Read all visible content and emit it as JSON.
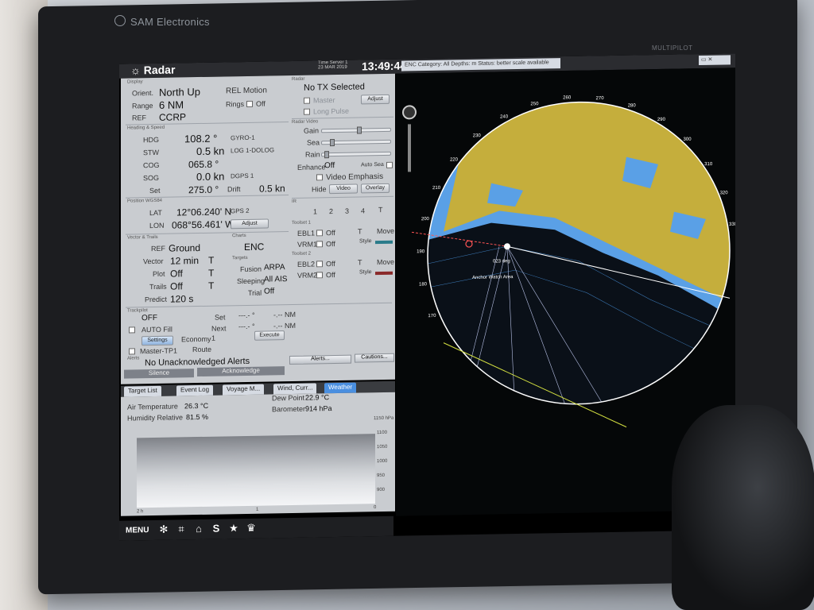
{
  "bezel": {
    "brand": "SAM Electronics",
    "model": "MULTIPILOT"
  },
  "topbar": {
    "title": "Radar",
    "time_zone_line1": "Time Server 1",
    "time_zone_line2": "23 MAR 2019",
    "clock": "13:49:44 LT",
    "enc_status": "ENC Category: All  Depths: m  Status: better scale available"
  },
  "display": {
    "section": "Display",
    "orient_label": "Orient.",
    "orient_value": "North Up",
    "motion": "REL Motion",
    "range_label": "Range",
    "range_value": "6 NM",
    "rings_label": "Rings",
    "rings_value": "Off",
    "ref_label": "REF",
    "ref_value": "CCRP"
  },
  "heading": {
    "section": "Heading & Speed",
    "hdg_label": "HDG",
    "hdg_value": "108.2 °",
    "hdg_source": "GYRO-1",
    "stw_label": "STW",
    "stw_value": "0.5 kn",
    "stw_source": "LOG 1-DOLOG",
    "cog_label": "COG",
    "cog_value": "065.8 °",
    "sog_label": "SOG",
    "sog_value": "0.0 kn",
    "sog_source": "DGPS 1",
    "set_label": "Set",
    "set_value": "275.0 °",
    "drift_label": "Drift",
    "drift_value": "0.5 kn"
  },
  "position": {
    "section": "Position WGS84",
    "lat_label": "LAT",
    "lat_value": "12°06.240' N",
    "lat_source": "GPS 2",
    "lon_label": "LON",
    "lon_value": "068°56.461' W",
    "adjust": "Adjust"
  },
  "vector": {
    "section": "Vector & Trails",
    "ref_label": "REF",
    "ref_value": "Ground",
    "vector_label": "Vector",
    "vector_value": "12 min",
    "vector_mode": "T",
    "plot_label": "Plot",
    "plot_value": "Off",
    "plot_mode": "T",
    "trails_label": "Trails",
    "trails_value": "Off",
    "trails_mode": "T",
    "predict_label": "Predict",
    "predict_value": "120 s"
  },
  "charts": {
    "section": "Charts",
    "value": "ENC"
  },
  "targets": {
    "section": "Targets",
    "fusion_label": "Fusion",
    "fusion_value": "ARPA",
    "sleeping_label": "Sleeping",
    "sleeping_value": "All AIS",
    "trial_label": "Trial",
    "trial_value": "Off"
  },
  "radar_ctl": {
    "section": "Radar",
    "tx": "No TX Selected",
    "master": "Master",
    "adjust": "Adjust",
    "long_pulse": "Long Pulse",
    "video_section": "Radar Video",
    "gain": "Gain",
    "sea": "Sea",
    "rain": "Rain",
    "gain_level": 0.55,
    "sea_level": 0.12,
    "rain_level": 0.04,
    "enhance_label": "Enhance",
    "enhance_value": "Off",
    "auto_sea": "Auto Sea",
    "video_emphasis": "Video Emphasis",
    "hide_label": "Hide",
    "hide_video": "Video",
    "hide_overlay": "Overlay",
    "ir_section": "IR",
    "ir_1": "1",
    "ir_2": "2",
    "ir_3": "3",
    "ir_4": "4",
    "ir_mode": "T"
  },
  "toolset1": {
    "section": "Toolset 1",
    "ebl1": "EBL1",
    "ebl1_value": "Off",
    "mode": "T",
    "move": "Move",
    "vrm1": "VRM1",
    "vrm1_value": "Off",
    "style": "Style"
  },
  "toolset2": {
    "section": "Toolset 2",
    "ebl2": "EBL2",
    "ebl2_value": "Off",
    "mode": "T",
    "move": "Move",
    "vrm2": "VRM2",
    "vrm2_value": "Off",
    "style": "Style"
  },
  "trackpilot": {
    "section": "Trackpilot",
    "state": "OFF",
    "set_label": "Set",
    "set_value": "---.- °",
    "set_nm": "-.-- NM",
    "auto_fill": "AUTO Fill",
    "next_label": "Next",
    "next_value": "---.- °",
    "next_nm": "-.-- NM",
    "settings": "Settings",
    "economy_label": "Economy",
    "economy_value": "1",
    "execute": "Execute",
    "master_tp": "Master-TP1",
    "route": "Route"
  },
  "alerts": {
    "section": "Alerts",
    "message": "No Unacknowledged Alerts",
    "silence": "Silence",
    "acknowledge": "Acknowledge",
    "alerts_btn": "Alerts...",
    "cautions_btn": "Cautions..."
  },
  "tabs": [
    "Target List",
    "Event Log",
    "Voyage M...",
    "Wind, Curr...",
    "Weather"
  ],
  "weather": {
    "air_temp_label": "Air Temperature",
    "air_temp_value": "26.3 °C",
    "humidity_label": "Humidity Relative",
    "humidity_value": "81.5 %",
    "dew_label": "Dew Point",
    "dew_value": "22.9 °C",
    "baro_label": "Barometer",
    "baro_value": "914 hPa",
    "ticks": [
      "1150 hPa",
      "1100",
      "1050",
      "1000",
      "950",
      "900"
    ],
    "x_start": "2 h",
    "x_mid": "1",
    "x_end": "0"
  },
  "bottombar": {
    "menu": "MENU"
  },
  "radar_view": {
    "bearings": [
      "220",
      "230",
      "240",
      "250",
      "260",
      "270",
      "280",
      "290",
      "300",
      "310",
      "320",
      "330",
      "210",
      "200",
      "190",
      "180",
      "170"
    ],
    "own_ship_label": "Anchor Watch Area",
    "depth_label": "023 deg",
    "colors": {
      "land": "#c5ae3c",
      "shallow": "#5aa0e6",
      "deep": "#0a1018",
      "ring": "#ffffff"
    }
  }
}
